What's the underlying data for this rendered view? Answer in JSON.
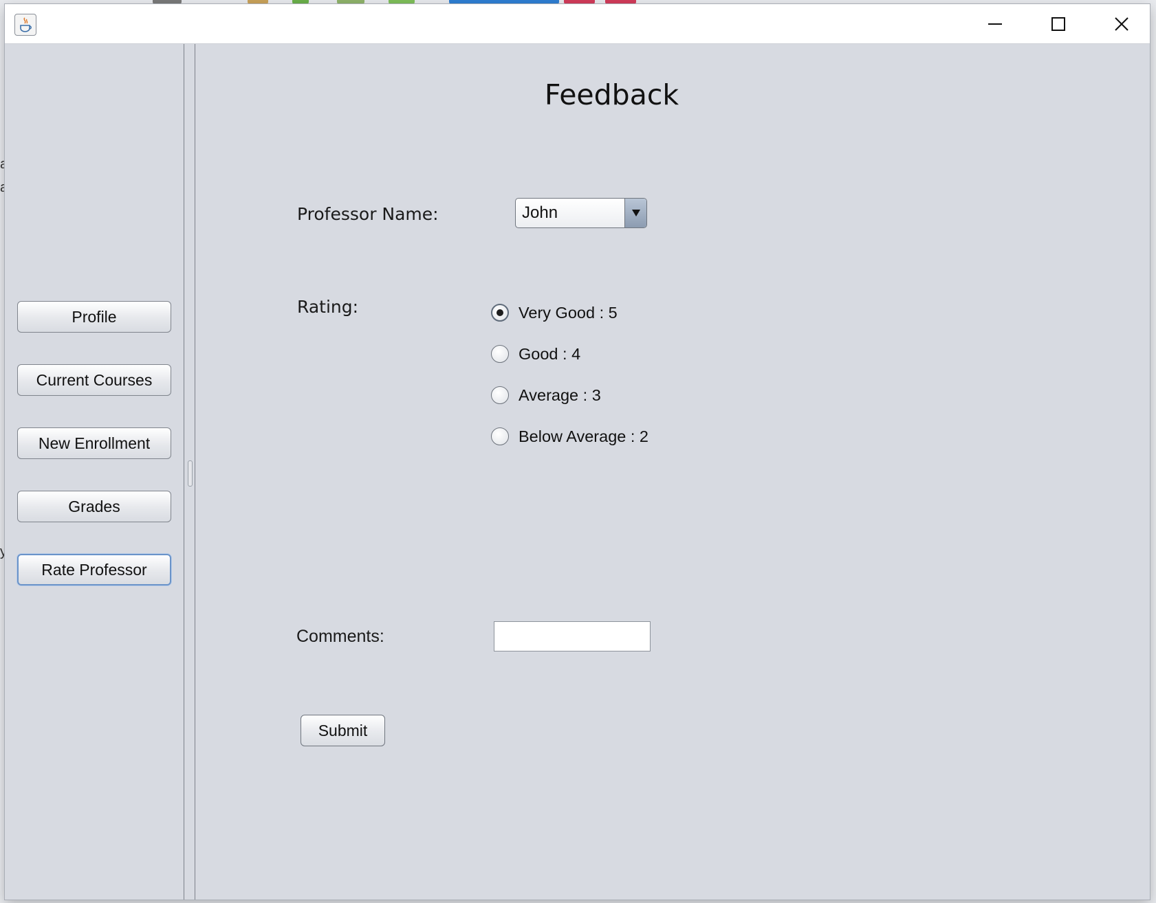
{
  "window": {
    "app_icon": "java-cup-icon",
    "controls": [
      "minimize-icon",
      "maximize-icon",
      "close-icon"
    ]
  },
  "sidebar": {
    "items": [
      {
        "label": "Profile"
      },
      {
        "label": "Current Courses"
      },
      {
        "label": "New Enrollment"
      },
      {
        "label": "Grades"
      },
      {
        "label": "Rate Professor",
        "active": true
      }
    ]
  },
  "main": {
    "title": "Feedback",
    "professor_label": "Professor Name:",
    "professor_selected": "John",
    "rating_label": "Rating:",
    "rating_options": [
      {
        "label": "Very Good : 5",
        "checked": true
      },
      {
        "label": "Good : 4",
        "checked": false
      },
      {
        "label": "Average : 3",
        "checked": false
      },
      {
        "label": "Below Average : 2",
        "checked": false
      }
    ],
    "comments_label": "Comments:",
    "comments_value": "",
    "submit_label": "Submit"
  },
  "colors": {
    "window_bg": "#d7dae1",
    "active_focus": "#6a93c9",
    "combo_arrow": "#8c9cb1"
  }
}
